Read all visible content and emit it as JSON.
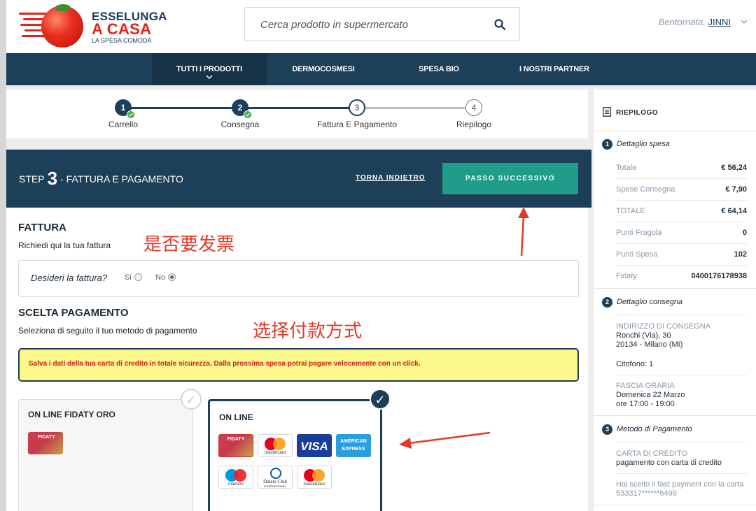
{
  "header": {
    "brand_line1": "ESSELUNGA",
    "brand_line2": "A CASA",
    "brand_tagline": "LA SPESA COMODA",
    "search_placeholder": "Cerca prodotto in supermercato",
    "greeting": "Bentornata,",
    "username": "JINNI"
  },
  "nav": {
    "items": [
      {
        "label": "TUTTI I PRODOTTI"
      },
      {
        "label": "DERMOCOSMESI"
      },
      {
        "label": "SPESA BIO"
      },
      {
        "label": "I NOSTRI PARTNER"
      }
    ]
  },
  "progress": {
    "steps": [
      {
        "num": "1",
        "label": "Carrello",
        "state": "done"
      },
      {
        "num": "2",
        "label": "Consegna",
        "state": "done"
      },
      {
        "num": "3",
        "label": "Fattura E Pagamento",
        "state": "current"
      },
      {
        "num": "4",
        "label": "Riepilogo",
        "state": "todo"
      }
    ]
  },
  "stepbar": {
    "prefix": "STEP",
    "number": "3",
    "suffix": "- FATTURA E PAGAMENTO",
    "back_label": "TORNA INDIETRO",
    "next_label": "PASSO SUCCESSIVO"
  },
  "invoice": {
    "title": "FATTURA",
    "subtitle": "Richiedi qui la tua fattura",
    "annotation": "是否要发票",
    "question": "Desideri la fattura?",
    "yes_label": "Si",
    "no_label": "No",
    "selected": "No"
  },
  "payment": {
    "title": "SCELTA PAGAMENTO",
    "subtitle": "Seleziona di seguito il tuo metodo di pagamento",
    "annotation": "选择付款方式",
    "notice": "Salva i dati della tua carta di credito in totale sicurezza. Dalla prossima spesa potrai pagare velocemente con un click.",
    "options": [
      {
        "title": "ON LINE FIDATY ORO",
        "selected": false
      },
      {
        "title": "ON LINE",
        "selected": true
      }
    ],
    "card_logos": {
      "fidaty": "FIDATY",
      "mastercard": "mastercard",
      "visa": "VISA",
      "amex_line1": "AMERICAN",
      "amex_line2": "EXPRESS",
      "maestro": "maestro",
      "diners_line1": "Diners Club",
      "diners_line2": "INTERNATIONAL",
      "masterpass": "masterpass"
    },
    "check_mark": "✓"
  },
  "summary": {
    "title": "RIEPILOGO",
    "spesa": {
      "num": "1",
      "title": "Dettaglio spesa",
      "rows": [
        {
          "key": "Totale",
          "value": "€ 56,24"
        },
        {
          "key": "Spese Consegna",
          "value": "€ 7,90"
        },
        {
          "key": "TOTALE",
          "value": "€ 64,14"
        },
        {
          "key": "Punti Fragola",
          "value": "0"
        },
        {
          "key": "Punti Spesa",
          "value": "102"
        },
        {
          "key": "Fidaty",
          "value": "0400176178938"
        }
      ]
    },
    "consegna": {
      "num": "2",
      "title": "Dettaglio consegna",
      "address_label": "INDIRIZZO DI CONSEGNA",
      "address_line1": "Ronchi (Via), 30",
      "address_line2": "20134 - Milano (MI)",
      "citofono": "Citofono: 1",
      "slot_label": "FASCIA ORARIA",
      "slot_day": "Domenica 22 Marzo",
      "slot_time": "ore 17:00 - 19:00"
    },
    "metodo": {
      "num": "3",
      "title": "Metodo di Pagamento",
      "method_label": "CARTA DI CREDITO",
      "method_desc": "pagamento con carta di credito",
      "fast_line1": "Hai scelto il fast payment con la carta",
      "fast_line2": "533317******6499"
    }
  },
  "colors": {
    "navy": "#1d3f57",
    "teal": "#1f9c8a",
    "brand_red": "#e2231a",
    "annotation_red": "#e23a2a",
    "notice_yellow": "#fbf78b"
  }
}
